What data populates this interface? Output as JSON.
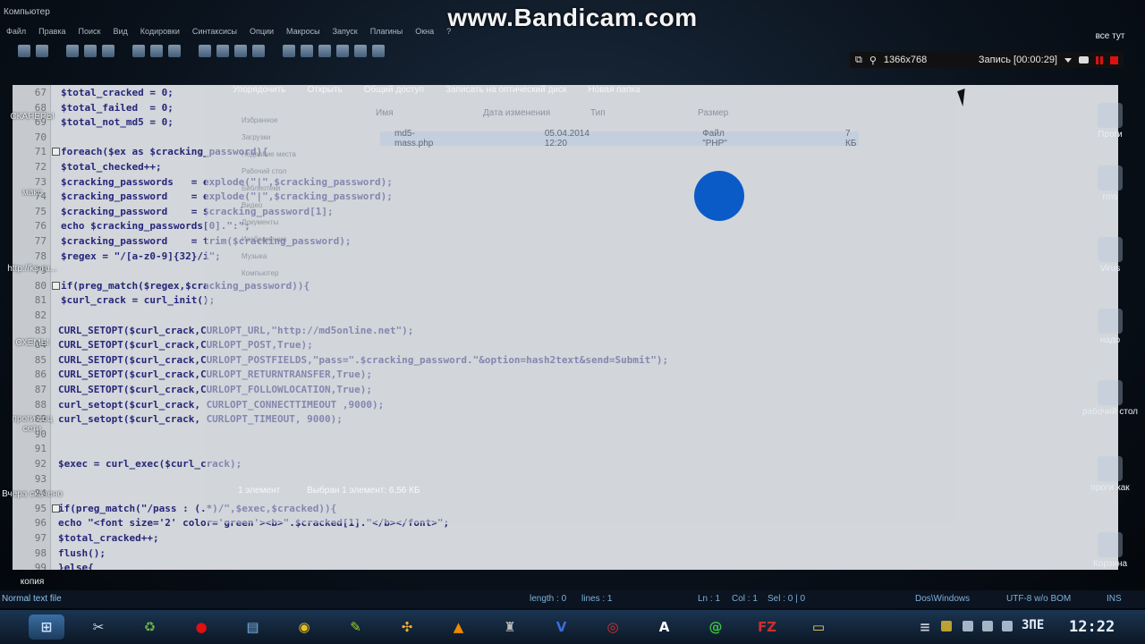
{
  "watermark": "www.Bandicam.com",
  "top_title": "Компьютер",
  "menu": [
    "Файл",
    "Правка",
    "Поиск",
    "Вид",
    "Кодировки",
    "Синтаксисы",
    "Опции",
    "Макросы",
    "Запуск",
    "Плагины",
    "Окна",
    "?"
  ],
  "recorder": {
    "resolution": "1366x768",
    "record_label": "Запись [00:00:29]"
  },
  "code_lines": [
    {
      "n": "67",
      "text": "$total_cracked = 0;"
    },
    {
      "n": "68",
      "text": "$total_failed  = 0;"
    },
    {
      "n": "69",
      "text": "$total_not_md5 = 0;"
    },
    {
      "n": "70",
      "text": ""
    },
    {
      "n": "71",
      "text": "foreach($ex as $cracking_password){"
    },
    {
      "n": "72",
      "text": "$total_checked++;"
    },
    {
      "n": "73",
      "text": "$cracking_passwords   = explode(\"|\",$cracking_password);"
    },
    {
      "n": "74",
      "text": "$cracking_password    = explode(\"|\",$cracking_password);"
    },
    {
      "n": "75",
      "text": "$cracking_password    = $cracking_password[1];"
    },
    {
      "n": "76",
      "text": "echo $cracking_passwords[0].\":\";"
    },
    {
      "n": "77",
      "text": "$cracking_password    = trim($cracking_password);"
    },
    {
      "n": "78",
      "text": "$regex = \"/[a-z0-9]{32}/i\";"
    },
    {
      "n": "79",
      "text": ""
    },
    {
      "n": "80",
      "text": "if(preg_match($regex,$cracking_password)){"
    },
    {
      "n": "81",
      "text": "$curl_crack = curl_init();"
    },
    {
      "n": "82",
      "text": ""
    },
    {
      "n": "83",
      "text": "CURL_SETOPT($curl_crack,CURLOPT_URL,\"http://md5online.net\");"
    },
    {
      "n": "84",
      "text": "CURL_SETOPT($curl_crack,CURLOPT_POST,True);"
    },
    {
      "n": "85",
      "text": "CURL_SETOPT($curl_crack,CURLOPT_POSTFIELDS,\"pass=\".$cracking_password.\"&option=hash2text&send=Submit\");"
    },
    {
      "n": "86",
      "text": "CURL_SETOPT($curl_crack,CURLOPT_RETURNTRANSFER,True);"
    },
    {
      "n": "87",
      "text": "CURL_SETOPT($curl_crack,CURLOPT_FOLLOWLOCATION,True);"
    },
    {
      "n": "88",
      "text": "curl_setopt($curl_crack, CURLOPT_CONNECTTIMEOUT ,9000);"
    },
    {
      "n": "89",
      "text": "curl_setopt($curl_crack, CURLOPT_TIMEOUT, 9000);"
    },
    {
      "n": "90",
      "text": ""
    },
    {
      "n": "91",
      "text": ""
    },
    {
      "n": "92",
      "text": "$exec = curl_exec($curl_crack);"
    },
    {
      "n": "93",
      "text": ""
    },
    {
      "n": "94",
      "text": ""
    },
    {
      "n": "95",
      "text": "if(preg_match(\"/pass : (.*)/\",$exec,$cracked)){"
    },
    {
      "n": "96",
      "text": "echo \"<font size='2' color='green'><b>\".$cracked[1].\"</b></font>\";"
    },
    {
      "n": "97",
      "text": "$total_cracked++;"
    },
    {
      "n": "98",
      "text": "flush();"
    },
    {
      "n": "99",
      "text": "}else{"
    }
  ],
  "explorer": {
    "toolbar": [
      "Упорядочить",
      "Открыть",
      "Общий доступ",
      "Записать на оптический диск",
      "Новая папка"
    ],
    "headers": [
      "Имя",
      "Дата изменения",
      "Тип",
      "Размер"
    ],
    "file": {
      "name": "md5-mass.php",
      "date": "05.04.2014 12:20",
      "type": "Файл \"PHP\"",
      "size": "7 КБ"
    },
    "nav": [
      "Избранное",
      "Загрузки",
      "Недавние места",
      "Рабочий стол",
      "Библиотеки",
      "Видео",
      "Документы",
      "Изображения",
      "Музыка",
      "Компьютер"
    ],
    "status": [
      "1 элемент",
      "Выбран 1 элемент: 6,56 КБ"
    ]
  },
  "desktop_right": [
    "все тут",
    "Проги",
    "rms",
    "Virus",
    "надо",
    "рабочий стол",
    "проги хак",
    "Корзина"
  ],
  "desktop_left": [
    "СКАНЕРЫ",
    "макс",
    "http://ks-ru...",
    "СХЕМЫ",
    "проги соц сети",
    "Вчера скачено",
    "копия"
  ],
  "status": {
    "file_type": "Normal text file",
    "length": "length : 0",
    "lines": "lines : 1",
    "ln": "Ln : 1",
    "col": "Col : 1",
    "sel": "Sel : 0 | 0",
    "eol": "Dos\\Windows",
    "encoding": "UTF-8 w/o BOM",
    "mode": "INS"
  },
  "taskbar_icons": [
    {
      "name": "scissors-icon",
      "glyph": "✂",
      "color": "#d8d8d8"
    },
    {
      "name": "recycle-icon",
      "glyph": "♻",
      "color": "#6ab04c"
    },
    {
      "name": "record-icon",
      "glyph": "●",
      "color": "#e01010"
    },
    {
      "name": "notepad-icon",
      "glyph": "▤",
      "color": "#7fb4e8"
    },
    {
      "name": "chrome-icon",
      "glyph": "◉",
      "color": "#e8c020"
    },
    {
      "name": "notepadpp-icon",
      "glyph": "✎",
      "color": "#9acd32"
    },
    {
      "name": "mediaget-icon",
      "glyph": "✣",
      "color": "#f0b030"
    },
    {
      "name": "avast-icon",
      "glyph": "▲",
      "color": "#f08a00"
    },
    {
      "name": "wot-icon",
      "glyph": "♜",
      "color": "#bbbbbb"
    },
    {
      "name": "virtualdub-icon",
      "glyph": "V",
      "color": "#3a6cd8"
    },
    {
      "name": "opera-icon",
      "glyph": "◎",
      "color": "#e03030"
    },
    {
      "name": "font-icon",
      "glyph": "A",
      "color": "#ffffff"
    },
    {
      "name": "mail-icon",
      "glyph": "@",
      "color": "#3cc03c"
    },
    {
      "name": "filezilla-icon",
      "glyph": "FZ",
      "color": "#c83030"
    },
    {
      "name": "folder-icon",
      "glyph": "▭",
      "color": "#f0d060"
    }
  ],
  "tray": {
    "lang": "ЗПЕ",
    "clock": "12:22"
  }
}
